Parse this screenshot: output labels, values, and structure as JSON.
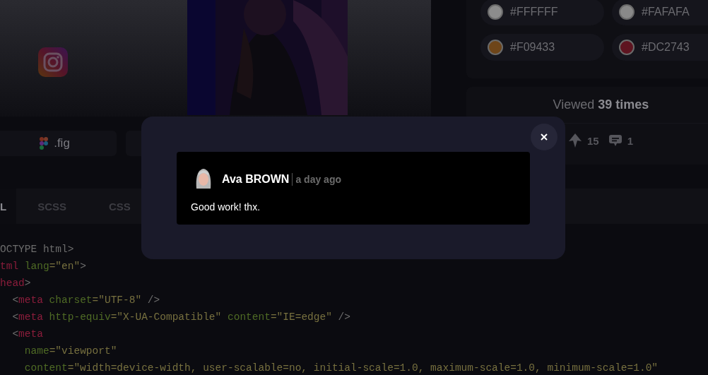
{
  "preview": {
    "picture": {
      "kind": "picture"
    }
  },
  "files": [
    {
      "kind": "figma",
      "label": ".fig"
    },
    {
      "kind": "blank"
    }
  ],
  "colors": [
    {
      "hex": "#FFFFFF",
      "color": "#8c8c8c"
    },
    {
      "hex": "#FAFAFA",
      "color": "#898989"
    },
    {
      "hex": "#F09433",
      "color": "#6e4519"
    },
    {
      "hex": "#DC2743",
      "color": "#5e1420"
    }
  ],
  "stats": {
    "views": "Viewed **39 times**",
    "upvotes": "15",
    "comments": "1"
  },
  "code_tabs": [
    {
      "label": "L",
      "selected": true
    },
    {
      "label": "SCSS",
      "selected": false
    },
    {
      "label": "CSS",
      "selected": false
    }
  ],
  "code_lines": [
    [
      {
        "kind": "punct",
        "text": "OCTYPE html>"
      }
    ],
    [
      {
        "kind": "tag",
        "text": "tml"
      },
      {
        "kind": "attr",
        "text": " lang"
      },
      {
        "kind": "str",
        "text": "=\"en\""
      },
      {
        "kind": "punct",
        "text": ">"
      }
    ],
    [
      {
        "kind": "tag",
        "text": "head"
      },
      {
        "kind": "punct",
        "text": ">"
      }
    ],
    [
      {
        "kind": "punct",
        "text": "  <"
      },
      {
        "kind": "tag",
        "text": "meta"
      },
      {
        "kind": "attr",
        "text": " charset"
      },
      {
        "kind": "str",
        "text": "=\"UTF-8\""
      },
      {
        "kind": "punct",
        "text": " />"
      }
    ],
    [
      {
        "kind": "punct",
        "text": "  <"
      },
      {
        "kind": "tag",
        "text": "meta"
      },
      {
        "kind": "attr",
        "text": " http-equiv"
      },
      {
        "kind": "str",
        "text": "=\"X-UA-Compatible\""
      },
      {
        "kind": "attr",
        "text": " content"
      },
      {
        "kind": "str",
        "text": "=\"IE=edge\""
      },
      {
        "kind": "punct",
        "text": " />"
      }
    ],
    [
      {
        "kind": "punct",
        "text": "  <"
      },
      {
        "kind": "tag",
        "text": "meta"
      }
    ],
    [
      {
        "kind": "attr",
        "text": "    name"
      },
      {
        "kind": "str",
        "text": "=\"viewport\""
      }
    ],
    [
      {
        "kind": "attr",
        "text": "    content"
      },
      {
        "kind": "str",
        "text": "=\"width=device-width, user-scalable=no, initial-scale=1.0, maximum-scale=1.0, minimum-scale=1.0\""
      }
    ]
  ],
  "modal": {
    "comment": {
      "author": "Ava BROWN",
      "time": "a day ago",
      "text": "Good work! thx."
    }
  }
}
